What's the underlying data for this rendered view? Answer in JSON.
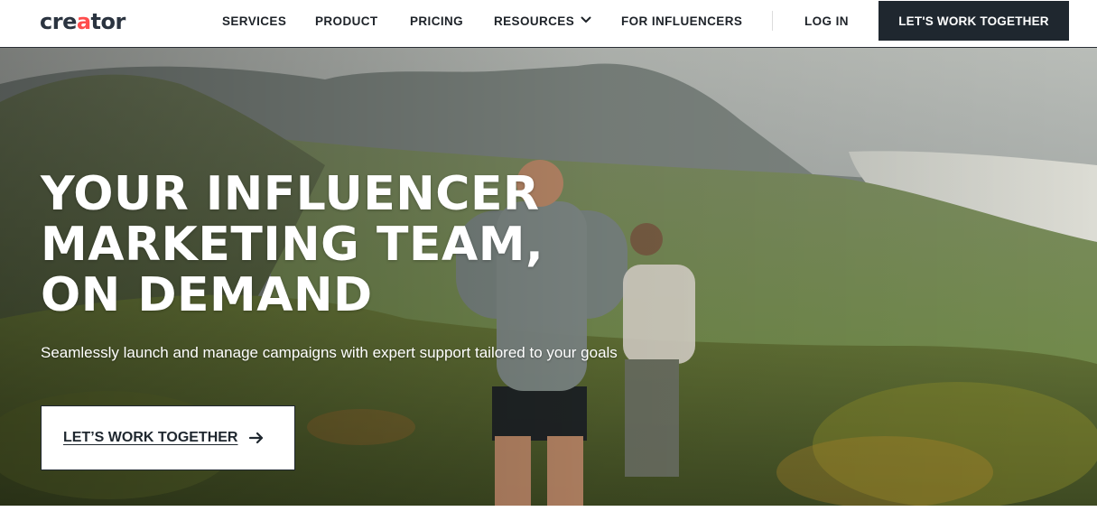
{
  "header": {
    "logo": {
      "text_before": "cre",
      "text_accent": "a",
      "text_after": "tor"
    },
    "nav": {
      "services": "SERVICES",
      "product": "PRODUCT",
      "pricing": "PRICING",
      "resources": "RESOURCES",
      "influencers": "FOR INFLUENCERS",
      "login": "LOG IN"
    },
    "cta_label": "LET'S WORK TOGETHER"
  },
  "hero": {
    "headline": [
      "YOUR INFLUENCER",
      "MARKETING TEAM,",
      "ON DEMAND"
    ],
    "subheadline": "Seamlessly launch and manage campaigns with expert support tailored to your goals",
    "cta_label": "LET’S WORK TOGETHER"
  },
  "icons": {
    "resources_dropdown": "chevron-down-icon",
    "hero_cta": "arrow-right-icon"
  },
  "colors": {
    "brand_dark": "#1f272f",
    "logo_accent": "#ff4d4d",
    "headline_text": "#ffffff"
  }
}
